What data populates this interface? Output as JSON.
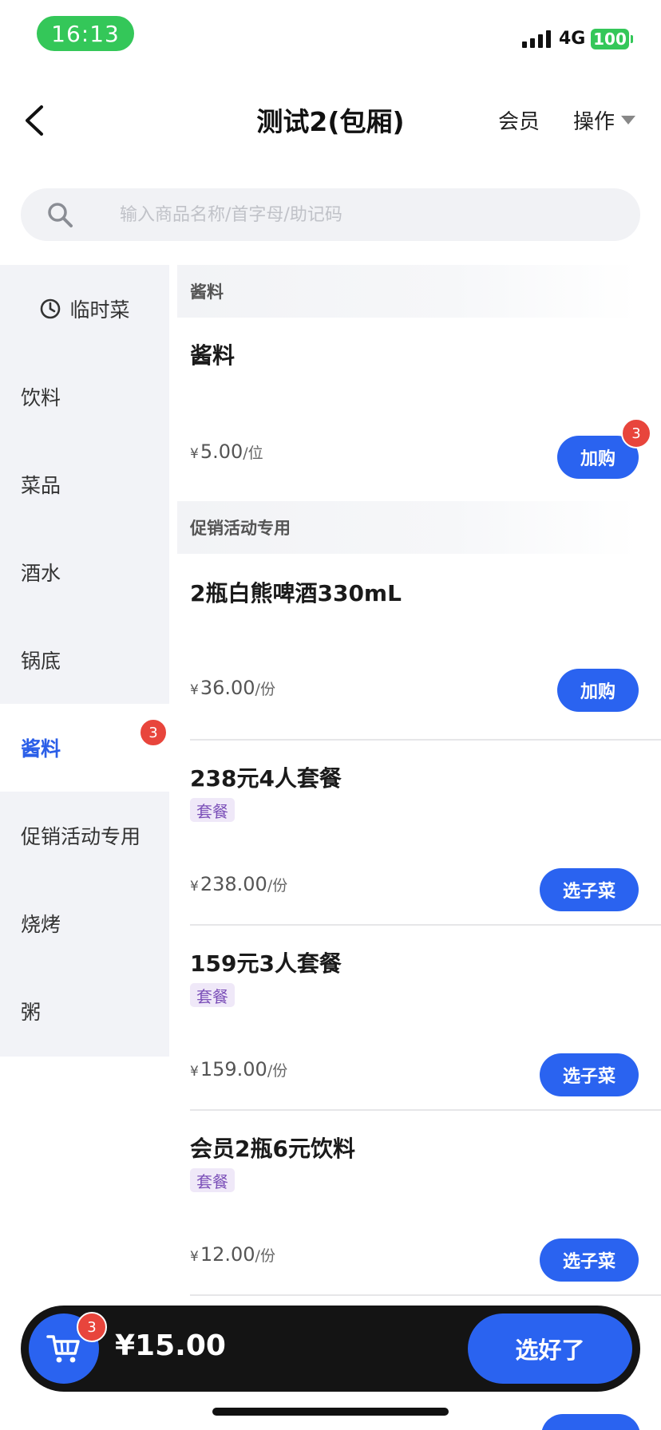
{
  "status_bar": {
    "time": "16:13",
    "network": "4G",
    "battery": "100"
  },
  "nav": {
    "title": "测试2(包厢)",
    "member": "会员",
    "operations": "操作"
  },
  "search": {
    "placeholder": "输入商品名称/首字母/助记码"
  },
  "sidebar": {
    "items": [
      {
        "label": "临时菜"
      },
      {
        "label": "饮料"
      },
      {
        "label": "菜品"
      },
      {
        "label": "酒水"
      },
      {
        "label": "锅底"
      },
      {
        "label": "酱料",
        "badge": "3"
      },
      {
        "label": "促销活动专用"
      },
      {
        "label": "烧烤"
      },
      {
        "label": "粥"
      }
    ]
  },
  "sections": [
    {
      "title": "酱料",
      "products": [
        {
          "name": "酱料",
          "currency": "¥",
          "price": "5.00",
          "unit": "/位",
          "action": "加购",
          "badge": "3"
        }
      ]
    },
    {
      "title": "促销活动专用",
      "products": [
        {
          "name": "2瓶白熊啤酒330mL",
          "currency": "¥",
          "price": "36.00",
          "unit": "/份",
          "action": "加购"
        },
        {
          "name": "238元4人套餐",
          "tag": "套餐",
          "currency": "¥",
          "price": "238.00",
          "unit": "/份",
          "action": "选子菜"
        },
        {
          "name": "159元3人套餐",
          "tag": "套餐",
          "currency": "¥",
          "price": "159.00",
          "unit": "/份",
          "action": "选子菜"
        },
        {
          "name": "会员2瓶6元饮料",
          "tag": "套餐",
          "currency": "¥",
          "price": "12.00",
          "unit": "/份",
          "action": "选子菜"
        }
      ]
    }
  ],
  "cart": {
    "count": "3",
    "total": "¥15.00",
    "checkout": "选好了"
  },
  "colors": {
    "accent": "#2a63f0",
    "badge": "#e8453c",
    "status_green": "#34c759",
    "tag_bg": "#efe8f8",
    "tag_text": "#7b4fb8"
  }
}
